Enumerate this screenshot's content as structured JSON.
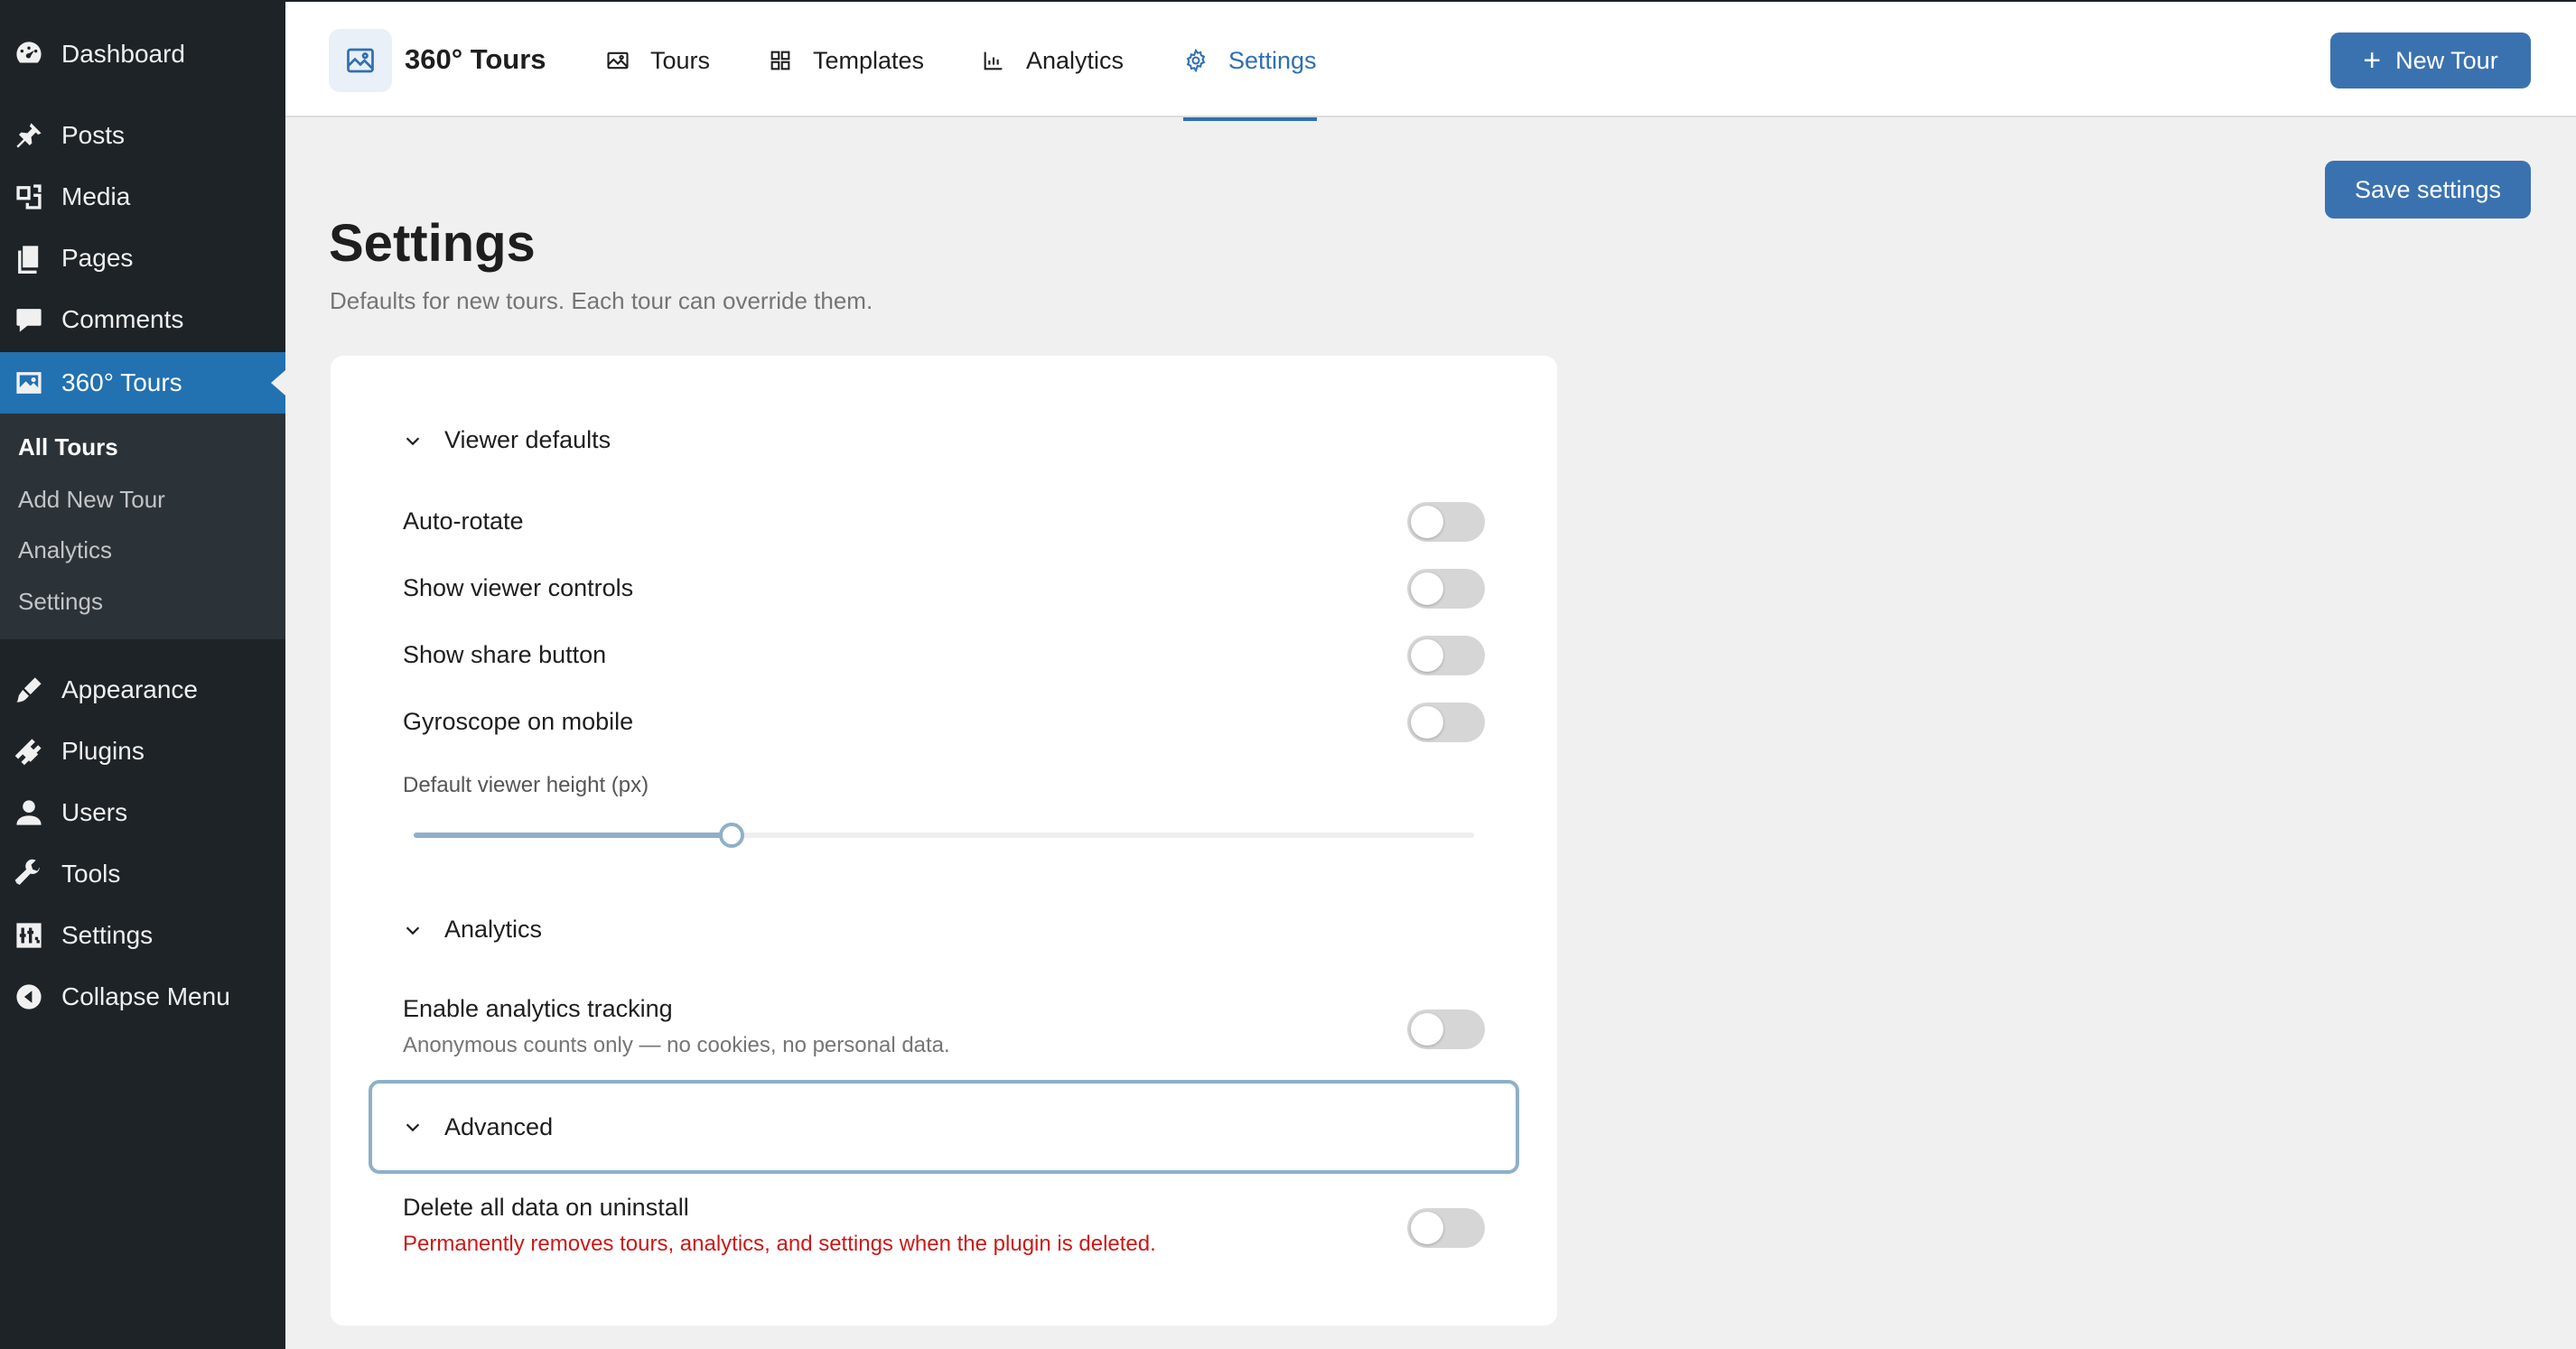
{
  "sidebar": {
    "items": [
      {
        "label": "Dashboard",
        "icon": "dashboard-icon"
      },
      {
        "label": "Posts",
        "icon": "pin-icon"
      },
      {
        "label": "Media",
        "icon": "media-icon"
      },
      {
        "label": "Pages",
        "icon": "pages-icon"
      },
      {
        "label": "Comments",
        "icon": "comment-icon"
      },
      {
        "label": "360° Tours",
        "icon": "tours-icon",
        "active": true
      },
      {
        "label": "Appearance",
        "icon": "brush-icon"
      },
      {
        "label": "Plugins",
        "icon": "plugin-icon"
      },
      {
        "label": "Users",
        "icon": "user-icon"
      },
      {
        "label": "Tools",
        "icon": "wrench-icon"
      },
      {
        "label": "Settings",
        "icon": "sliders-icon"
      },
      {
        "label": "Collapse Menu",
        "icon": "collapse-icon"
      }
    ],
    "submenu": [
      {
        "label": "All Tours",
        "current": true
      },
      {
        "label": "Add New Tour"
      },
      {
        "label": "Analytics"
      },
      {
        "label": "Settings"
      }
    ]
  },
  "header": {
    "brand": "360° Tours",
    "tabs": [
      {
        "label": "Tours",
        "icon": "image-icon"
      },
      {
        "label": "Templates",
        "icon": "grid-icon"
      },
      {
        "label": "Analytics",
        "icon": "bar-chart-icon"
      },
      {
        "label": "Settings",
        "icon": "gear-icon",
        "active": true
      }
    ],
    "new_tour_label": "New Tour"
  },
  "page": {
    "title": "Settings",
    "subtitle": "Defaults for new tours. Each tour can override them.",
    "save_label": "Save settings"
  },
  "sections": {
    "viewer": {
      "title": "Viewer defaults",
      "toggles": [
        {
          "label": "Auto-rotate",
          "on": false
        },
        {
          "label": "Show viewer controls",
          "on": false
        },
        {
          "label": "Show share button",
          "on": false
        },
        {
          "label": "Gyroscope on mobile",
          "on": false
        }
      ],
      "height_label": "Default viewer height (px)",
      "height_fraction": 0.3
    },
    "analytics": {
      "title": "Analytics",
      "toggle_label": "Enable analytics tracking",
      "toggle_help": "Anonymous counts only — no cookies, no personal data.",
      "on": false
    },
    "advanced": {
      "title": "Advanced",
      "toggle_label": "Delete all data on uninstall",
      "toggle_help": "Permanently removes tours, analytics, and settings when the plugin is deleted.",
      "on": false
    }
  },
  "colors": {
    "sidebar_bg": "#1d2327",
    "accent": "#2271b1",
    "button": "#3a72b0",
    "danger": "#cc1818"
  }
}
